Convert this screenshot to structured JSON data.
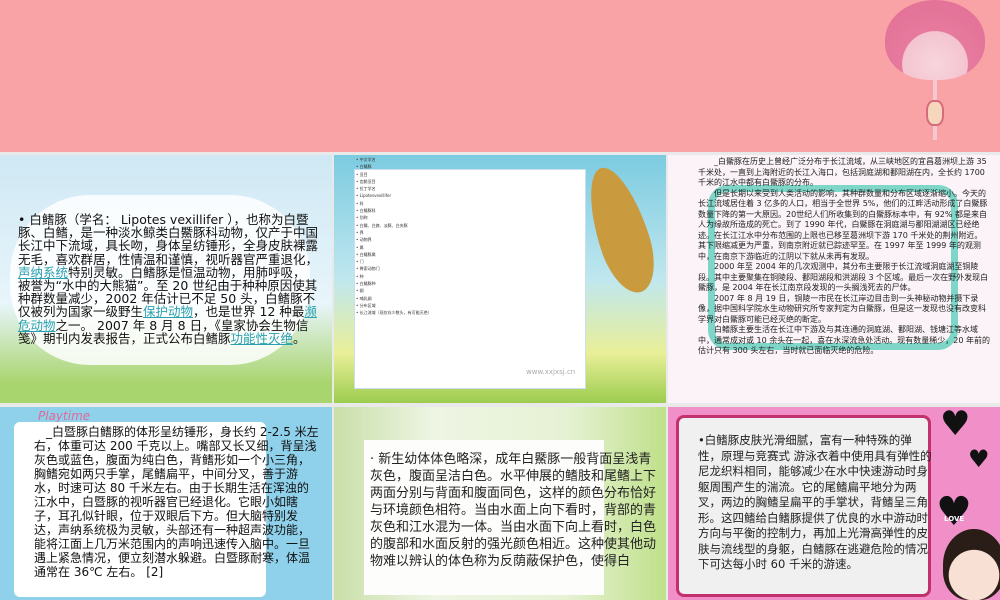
{
  "slides": [
    {
      "bullet": "•",
      "text_a": "白鳍豚（学名： Lipotes vexillifer ），也称为白暨豚、白鳍，是一种淡水鲸类白鱀豚科动物，仅产于中国长江中下流域，具长吻，身体呈纺锤形，全身皮肤裸露无毛，喜欢群居，性情温和谨慎，视听器官严重退化，",
      "link1": "声纳系统",
      "text_b": "特别灵敏。白鳍豚是恒温动物，用肺呼吸，被誉为“水中的大熊猫”。至 20 世纪由于种种原因使其种群数量减少，2002 年估计已不足 50 头，白鳍豚不仅被列为国家一级野生",
      "link2": "保护动物",
      "text_c": "，也是世界 12 种最",
      "link3": "濒危动物",
      "text_d": "之一。 2007 年 8 月 8 日，《皇家协会生物信笺》期刊内发表报告，正式公布白鳍豚",
      "link4": "功能性灭绝",
      "text_e": "。"
    },
    {
      "items": [
        "中文学名",
        "白鳍豚",
        "亚目",
        "齿鲸亚目",
        "拉丁学名",
        "Lipotesvexillifer",
        "科",
        "白鳍豚科",
        "别称",
        "白鳍、白旗、淡豚、白夹豚",
        "界",
        "动物界",
        "属",
        "白鳍豚属",
        "门",
        "脊索动物门",
        "种",
        "白鳍豚种",
        "纲",
        "哺乳纲",
        "分布区域",
        "长江流域（现仅存少数头，有可能灭绝）"
      ],
      "watermark": "www.xxjxsj.cn"
    },
    {
      "paragraphs": [
        "_白鱀豚在历史上曾经广泛分布于长江流域，从三峡地区的宜昌葛洲坝上游 35 千米处，一直到上海附近的长江入海口，包括洞庭湖和鄱阳湖在内，全长约 1700 千米的江水中都有白鱀豚的分布。",
        "但是长期以来受到人类活动的影响，其种群数量和分布区域逐渐缩小。今天的长江流域居住着 3 亿多的人口，相当于全世界 5%，他们的江畔活动形成了白鱀豚数量下降的第一大原因。20世纪人们所收集到的白鱀豚标本中，有 92% 都是来自人为缘故所造成的死亡。到了 1990 年代，白鱀豚在洞庭湖与鄱阳湖湖区已经绝迹。在长江江水中分布范围的上限也已移至葛洲坝下游 170 千米处的荆州附近。其下限缩减更为严重，到南京附近就已踪迹罕至。在 1997 年至 1999 年的观测中，在南京下游临近的江阴以下就从未再有发现。",
        "2000 年至 2004 年的几次观测中，其分布主要限于长江流域洞庭湖至铜陵段。其中主要聚集在铜陵段、鄱阳湖段和洪湖段 3 个区域。最后一次在野外发现白鱀豚，是 2004 年在长江南京段发现的一头搁浅死去的尸体。",
        "2007 年 8 月 19 日，铜陵一市民在长江岸边目击到一头神秘动物并摄下录像，据中国科学院水生动物研究所专家判定为白鱀豚，但是这一发现也没有改变科学界对白鱀豚可能已经灭绝的断定。",
        "白鳍豚主要生活在长江中下游及与其连通的洞庭湖、鄱阳湖、钱塘江等水域中，通常成对或 10 余头在一起，喜在水深流急处活动。现有数量稀少，20 年前的估计只有 300 头左右，当时就已面临灭绝的危险。"
      ]
    },
    {
      "logo": "Playtime",
      "text": "_白暨豚白鳍豚的体形呈纺锤形，身长约 2-2.5 米左右，体重可达 200 千克以上。嘴部又长又细，背呈浅灰色或蓝色，腹面为纯白色，背鳍形如一个小三角，胸鳍宛如两只手掌，尾鳍扁平，中间分叉，善于游水，时速可达 80 千米左右。由于长期生活在浑浊的江水中，白暨豚的视听器官已经退化。它眼小如瞎子，耳孔似针眼，位于双眼后下方。但大脑特别发达，声纳系统极为灵敏，头部还有一种超声波功能，能将江面上几万米范围内的声响迅速传入脑中。一旦遇上紧急情况，便立刻潜水躲避。白暨豚耐寒，体温通常在 36℃ 左右。 [2]"
    },
    {
      "text": "·   新生幼体体色略深，成年白鱀豚一般背面呈浅青灰色，腹面呈洁白色。水平伸展的鳍肢和尾鳍上下两面分别与背面和腹面同色，这样的颜色分布恰好与环境颜色相符。当由水面上向下看时，背部的青灰色和江水混为一体。当由水面下向上看时，白色的腹部和水面反射的强光颜色相近。这种使其他动物难以辨认的体色称为反荫蔽保护色，使得白"
    },
    {
      "text": "•白鳍豚皮肤光滑细腻，富有一种特殊的弹性，原理与竞赛式 游泳衣着中使用具有弹性的尼龙织料相同，能够减少在水中快速游动时身躯周围产生的湍流。它的尾鳍扁平地分为两叉，两边的胸鳍呈扁平的手掌状，背鳍呈三角形。这四鳍给白鳍豚提供了优良的水中游动时方向与平衡的控制力，再加上光滑高弹性的皮肤与流线型的身躯，白鳍豚在逃避危险的情况下可达每小时 60 千米的游速。",
      "badge": "LOVE"
    }
  ]
}
